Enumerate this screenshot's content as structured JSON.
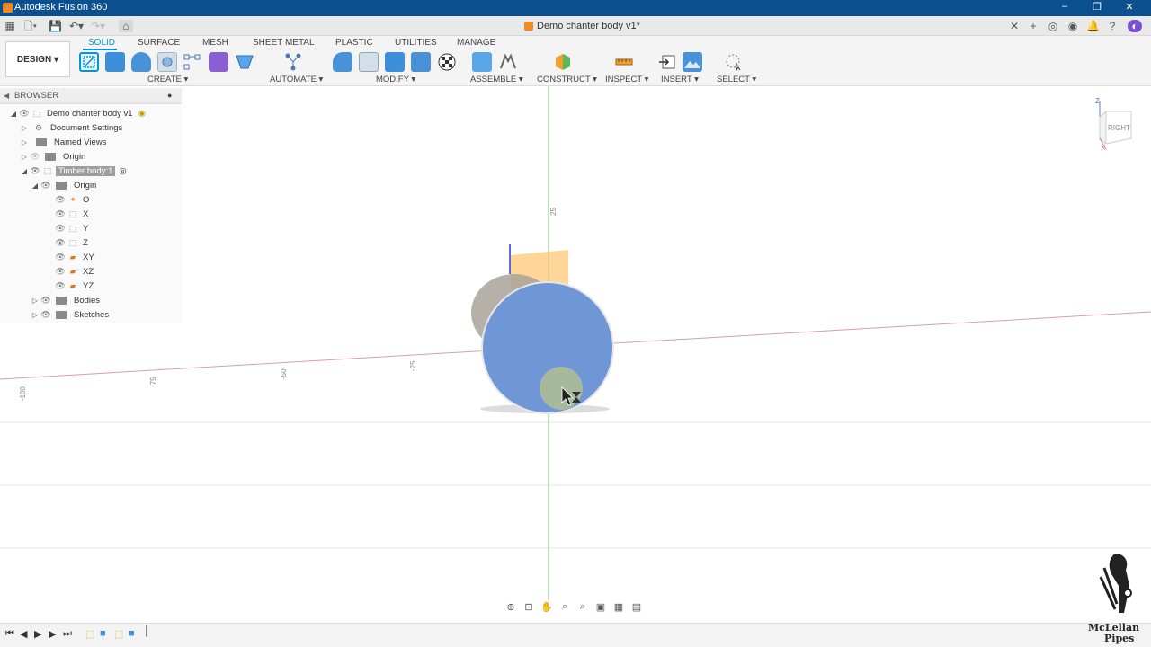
{
  "window": {
    "title": "Autodesk Fusion 360"
  },
  "document": {
    "title": "Demo chanter body v1*"
  },
  "workspace": {
    "label": "DESIGN ▾"
  },
  "tabs": [
    "SOLID",
    "SURFACE",
    "MESH",
    "SHEET METAL",
    "PLASTIC",
    "UTILITIES",
    "MANAGE"
  ],
  "groups": {
    "create": "CREATE ▾",
    "automate": "AUTOMATE ▾",
    "modify": "MODIFY ▾",
    "assemble": "ASSEMBLE ▾",
    "construct": "CONSTRUCT ▾",
    "inspect": "INSPECT ▾",
    "insert": "INSERT ▾",
    "select": "SELECT ▾"
  },
  "browser": {
    "header": "BROWSER",
    "items": [
      {
        "label": "Demo chanter body v1"
      },
      {
        "label": "Document Settings"
      },
      {
        "label": "Named Views"
      },
      {
        "label": "Origin"
      },
      {
        "label": "Timber body:1"
      },
      {
        "label": "Origin"
      },
      {
        "label": "O"
      },
      {
        "label": "X"
      },
      {
        "label": "Y"
      },
      {
        "label": "Z"
      },
      {
        "label": "XY"
      },
      {
        "label": "XZ"
      },
      {
        "label": "YZ"
      },
      {
        "label": "Bodies"
      },
      {
        "label": "Sketches"
      }
    ]
  },
  "viewport": {
    "axis_labels": [
      "-100",
      "-75",
      "-50",
      "-25",
      "25"
    ],
    "viewcube": {
      "face": "RIGHT",
      "axis_z": "Z",
      "axis_x": "X"
    }
  },
  "watermark": {
    "line1": "McLellan",
    "line2": "Pipes"
  },
  "colors": {
    "accent": "#0696d7",
    "titlebar": "#0b4f8f",
    "body_blue": "#6f97d6",
    "sketch_orange": "#ffc46b"
  }
}
